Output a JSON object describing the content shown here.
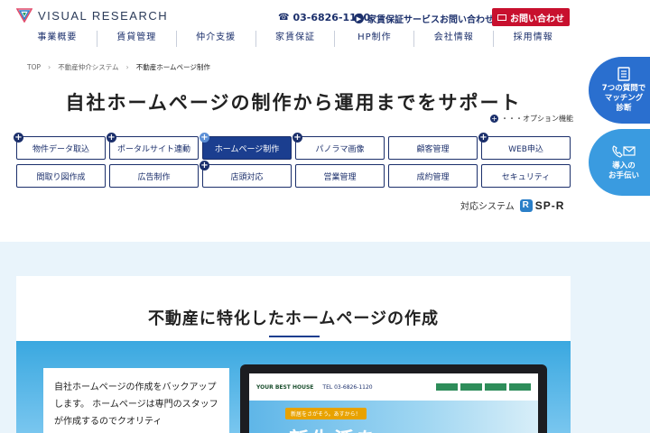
{
  "header": {
    "logo_text": "VISUAL RESEARCH",
    "phone": "03-6826-1120",
    "guarantee_link": "家賃保証サービスお問い合わせ",
    "contact_button": "お問い合わせ",
    "nav": [
      "事業概要",
      "賃貸管理",
      "仲介支援",
      "家賃保証",
      "HP制作",
      "会社情報",
      "採用情報"
    ]
  },
  "breadcrumb": {
    "items": [
      "TOP",
      "不動産仲介システム",
      "不動産ホームページ制作"
    ]
  },
  "main": {
    "title": "自社ホームページの制作から運用までをサポート",
    "option_note": "・・・オプション機能",
    "grid": [
      {
        "label": "物件データ取込",
        "plus": true,
        "active": false
      },
      {
        "label": "ポータルサイト連動",
        "plus": true,
        "active": false
      },
      {
        "label": "ホームページ制作",
        "plus": true,
        "active": true
      },
      {
        "label": "パノラマ画像",
        "plus": true,
        "active": false
      },
      {
        "label": "顧客管理",
        "plus": false,
        "active": false
      },
      {
        "label": "WEB申込",
        "plus": true,
        "active": false
      },
      {
        "label": "間取り図作成",
        "plus": false,
        "active": false
      },
      {
        "label": "広告制作",
        "plus": false,
        "active": false
      },
      {
        "label": "店頭対応",
        "plus": true,
        "active": false
      },
      {
        "label": "営業管理",
        "plus": false,
        "active": false
      },
      {
        "label": "成約管理",
        "plus": false,
        "active": false
      },
      {
        "label": "セキュリティ",
        "plus": false,
        "active": false
      }
    ],
    "system_label": "対応システム",
    "system_name": "SP-R"
  },
  "section": {
    "title": "不動産に特化したホームページの作成",
    "body": "自社ホームページの作成をバックアップします。 ホームページは専門のスタッフが作成するのでクオリティ",
    "screen": {
      "logo": "YOUR BEST HOUSE",
      "tel": "TEL 03-6826-1120",
      "ribbon": "新居をさがそう。あすから！",
      "hero": "新生活を"
    }
  },
  "side": {
    "quiz_button": "7つの質問で\nマッチング\n診断",
    "assist_button": "導入の\nお手伝い"
  },
  "colors": {
    "navy": "#1b2f6b",
    "accent_blue": "#1b3e8f",
    "red": "#c8102e",
    "light_bg": "#e9f4fb"
  }
}
